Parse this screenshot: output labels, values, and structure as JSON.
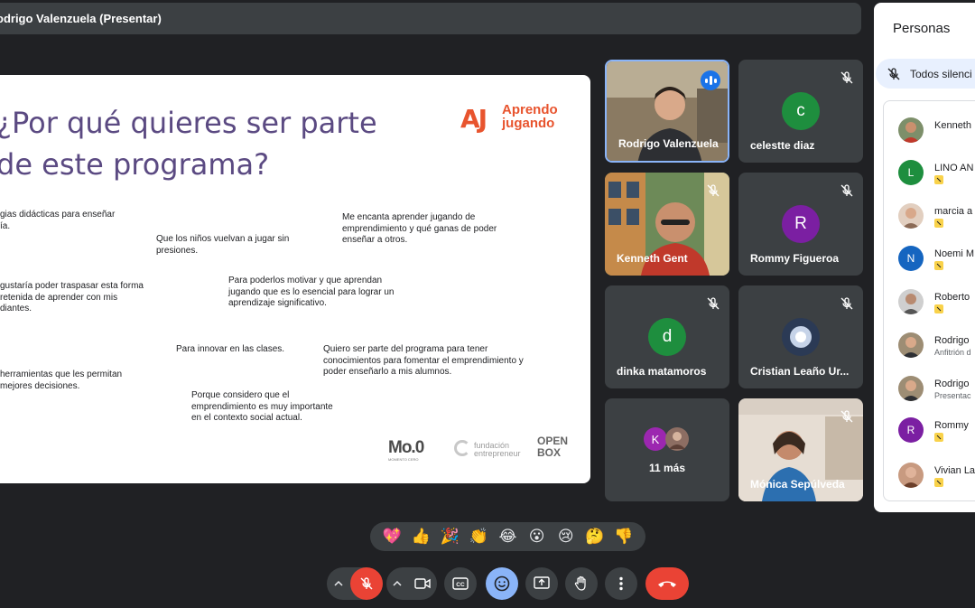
{
  "presenter_bar": {
    "label": "odrigo Valenzuela (Presentar)"
  },
  "slide": {
    "title_line1": "¿Por qué quieres ser parte",
    "title_line2": "de este programa?",
    "logo_word1": "Aprendo",
    "logo_word2": "jugando",
    "logo_mark": "AJ",
    "notes": [
      {
        "lines": [
          "gias didácticas para enseñar",
          "ía."
        ]
      },
      {
        "lines": [
          "Que los niños vuelvan a jugar sin",
          "presiones."
        ]
      },
      {
        "lines": [
          "Me encanta aprender jugando de",
          "emprendimiento y qué ganas de poder",
          "enseñar a otros."
        ]
      },
      {
        "lines": [
          "gustaría poder traspasar esta forma",
          "retenida de aprender con mis",
          "diantes."
        ]
      },
      {
        "lines": [
          "Para poderlos motivar y que aprendan",
          "jugando que es lo esencial para lograr un",
          "aprendizaje significativo."
        ]
      },
      {
        "lines": [
          "Para innovar en las clases."
        ]
      },
      {
        "lines": [
          "Quiero ser parte del programa para tener",
          "conocimientos para fomentar el emprendimiento y",
          "poder enseñarlo a mis alumnos."
        ]
      },
      {
        "lines": [
          "herramientas que les permitan",
          "mejores decisiones."
        ]
      },
      {
        "lines": [
          "Porque considero que el",
          "emprendimiento es muy importante",
          "en el contexto social actual."
        ]
      }
    ],
    "partners": {
      "mo_main": "Mo.0",
      "mo_sub": "MOMENTO CERO",
      "fund_line1": "fundación",
      "fund_line2": "entrepreneur",
      "open_line1": "OPEN",
      "open_line2": "BOX"
    }
  },
  "tiles": [
    {
      "name": "Rodrigo Valenzuela"
    },
    {
      "name": "celestte diaz",
      "initial": "c"
    },
    {
      "name": "Kenneth Gent"
    },
    {
      "name": "Rommy Figueroa",
      "initial": "R"
    },
    {
      "name": "dinka matamoros",
      "initial": "d"
    },
    {
      "name": "Cristian Leaño Ur..."
    },
    {
      "name": "11 más",
      "initial": "K"
    },
    {
      "name": "Mónica Sepúlveda"
    }
  ],
  "reactions": [
    "💖",
    "👍",
    "🎉",
    "👏",
    "😂",
    "😮",
    "😢",
    "🤔",
    "👎"
  ],
  "people": {
    "title": "Personas",
    "mute_all": "Todos silenci",
    "items": [
      {
        "name": "Kenneth"
      },
      {
        "name": "LINO AN",
        "initial": "L"
      },
      {
        "name": "marcia a"
      },
      {
        "name": "Noemi M",
        "initial": "N"
      },
      {
        "name": "Roberto"
      },
      {
        "name": "Rodrigo",
        "sub": "Anfitrión d"
      },
      {
        "name": "Rodrigo",
        "sub": "Presentac"
      },
      {
        "name": "Rommy",
        "initial": "R"
      },
      {
        "name": "Vivian La"
      }
    ]
  },
  "colors": {
    "background": "#202124",
    "tile": "#3c4043",
    "end_call": "#ea4335",
    "mic_off": "#ea4335",
    "emoji_active": "#8ab4f8",
    "slide_title": "#5b4a82",
    "brand_orange": "#e8542e"
  }
}
